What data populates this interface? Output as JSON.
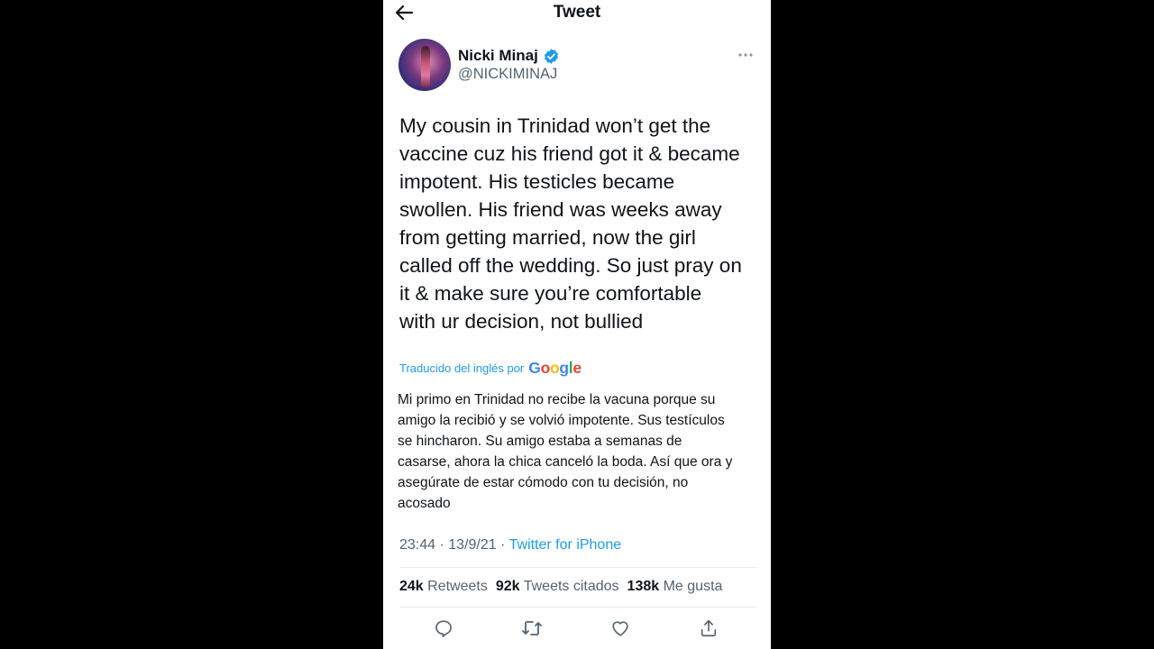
{
  "header": {
    "title": "Tweet",
    "back_icon": "arrow-left-icon"
  },
  "author": {
    "name": "Nicki Minaj",
    "handle": "@NICKIMINAJ",
    "verified_icon": "verified-badge-icon",
    "more_icon": "more-horizontal-icon"
  },
  "tweet": {
    "text": "My cousin in Trinidad won’t get the\nvaccine cuz his friend got it & became\nimpotent. His testicles became\nswollen. His friend was weeks away\nfrom getting married, now the girl\ncalled off the wedding. So just pray on\nit & make sure you’re comfortable\nwith ur decision, not bullied"
  },
  "translation": {
    "label": "Traducido del inglés por",
    "provider": "Google",
    "text": "Mi primo en Trinidad no recibe la vacuna porque su\namigo la recibió y se volvió impotente. Sus testículos\nse hincharon. Su amigo estaba a semanas de\ncasarse, ahora la chica canceló la boda. Así que ora y\nasegúrate de estar cómodo con tu decisión, no\nacosado"
  },
  "meta": {
    "time": "23:44",
    "sep1": "·",
    "date": "13/9/21",
    "sep2": "·",
    "source": "Twitter for iPhone"
  },
  "stats": [
    {
      "count": "24k",
      "label": "Retweets"
    },
    {
      "count": "92k",
      "label": "Tweets citados"
    },
    {
      "count": "138k",
      "label": "Me gusta"
    }
  ],
  "actions": [
    "reply-icon",
    "retweet-icon",
    "like-icon",
    "share-icon"
  ],
  "colors": {
    "accent": "#1d9bf0",
    "text": "#0f1419",
    "secondary": "#536471",
    "divider": "#e6ecf0"
  }
}
